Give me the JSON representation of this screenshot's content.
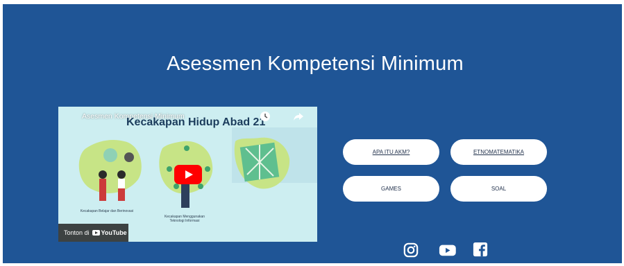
{
  "header": {
    "title": "Asessmen Kompetensi Minimum"
  },
  "video": {
    "title": "Asesmen Kompetensi Minimum",
    "banner": "Kecakapan Hidup Abad 21",
    "captions": [
      "Kecakapan Belajar dan Berinovasi",
      "Kecakapan Menggunakan Teknologi Informasi"
    ],
    "watch_label": "Tonton di",
    "platform": "YouTube"
  },
  "buttons": {
    "akm": "APA ITU AKM?",
    "etno": "ETNOMATEMATIKA",
    "games": "GAMES",
    "soal": "SOAL"
  },
  "social": [
    "instagram-icon",
    "youtube-icon",
    "facebook-icon"
  ],
  "colors": {
    "background": "#1f5596",
    "button": "#ffffff",
    "youtube_red": "#ff0000"
  }
}
